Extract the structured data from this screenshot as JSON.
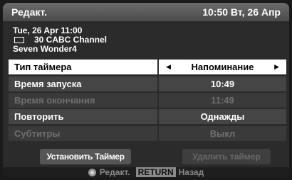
{
  "titlebar": {
    "title": "Редакт.",
    "clock": "10:50 Вт, 26 Апр"
  },
  "program": {
    "datetime": "Tue, 26 Apr 11:00",
    "channel": "30 CABC Channel",
    "name": "Seven Wonder4"
  },
  "settings": [
    {
      "label": "Тип таймера",
      "value": "Напоминание"
    },
    {
      "label": "Время запуска",
      "value": "10:49"
    },
    {
      "label": "Время окончания",
      "value": "11:49"
    },
    {
      "label": "Повторить",
      "value": "Однажды"
    },
    {
      "label": "Субтитры",
      "value": "Выкл"
    }
  ],
  "buttons": {
    "set_timer": "Установить Таймер",
    "delete_timer": "Удалить таймер"
  },
  "footer": {
    "edit": "Редакт.",
    "return_key": "RETURN",
    "back": "Назад"
  },
  "icons": {
    "arrow_left": "◀",
    "arrow_right": "▶"
  }
}
